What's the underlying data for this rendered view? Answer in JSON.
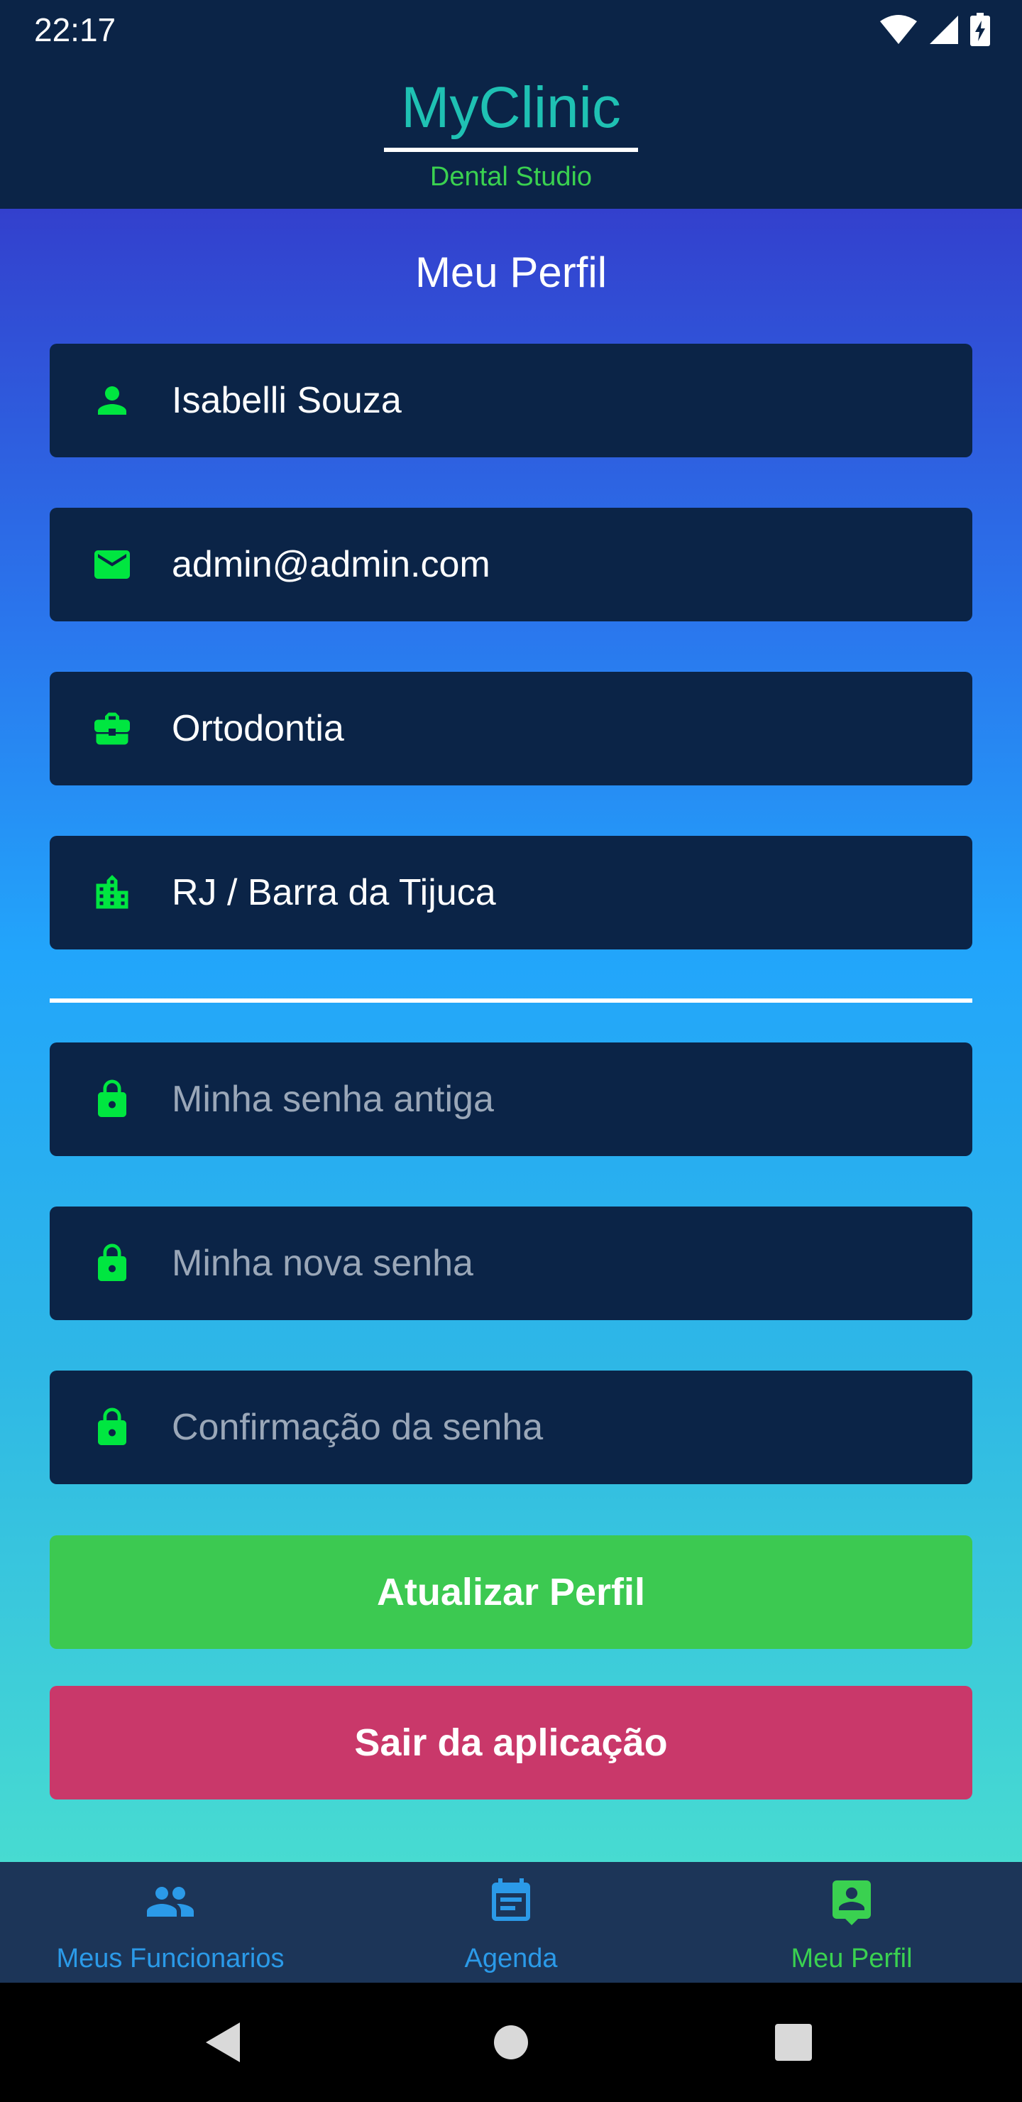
{
  "status": {
    "time": "22:17"
  },
  "header": {
    "title": "MyClinic",
    "subtitle": "Dental Studio"
  },
  "page": {
    "title": "Meu Perfil"
  },
  "profile": {
    "name": {
      "value": "Isabelli Souza",
      "icon": "person-icon"
    },
    "email": {
      "value": "admin@admin.com",
      "icon": "mail-icon"
    },
    "specialty": {
      "value": "Ortodontia",
      "icon": "briefcase-icon"
    },
    "location": {
      "value": "RJ / Barra da Tijuca",
      "icon": "building-icon"
    }
  },
  "password": {
    "old": {
      "placeholder": "Minha senha antiga",
      "icon": "lock-icon"
    },
    "new": {
      "placeholder": "Minha nova senha",
      "icon": "lock-icon"
    },
    "confirm": {
      "placeholder": "Confirmação da senha",
      "icon": "lock-icon"
    }
  },
  "buttons": {
    "update": "Atualizar Perfil",
    "logout": "Sair da aplicação"
  },
  "nav": {
    "items": [
      {
        "label": "Meus Funcionarios",
        "icon": "people-icon",
        "active": false
      },
      {
        "label": "Agenda",
        "icon": "calendar-icon",
        "active": false
      },
      {
        "label": "Meu Perfil",
        "icon": "profile-icon",
        "active": true
      }
    ]
  },
  "colors": {
    "header_bg": "#0b2447",
    "brand": "#1fc1b3",
    "accent_green": "#00e640",
    "button_green": "#3cc951",
    "button_red": "#c9386a",
    "nav_inactive": "#2b9ae8",
    "nav_active": "#3ad150"
  }
}
